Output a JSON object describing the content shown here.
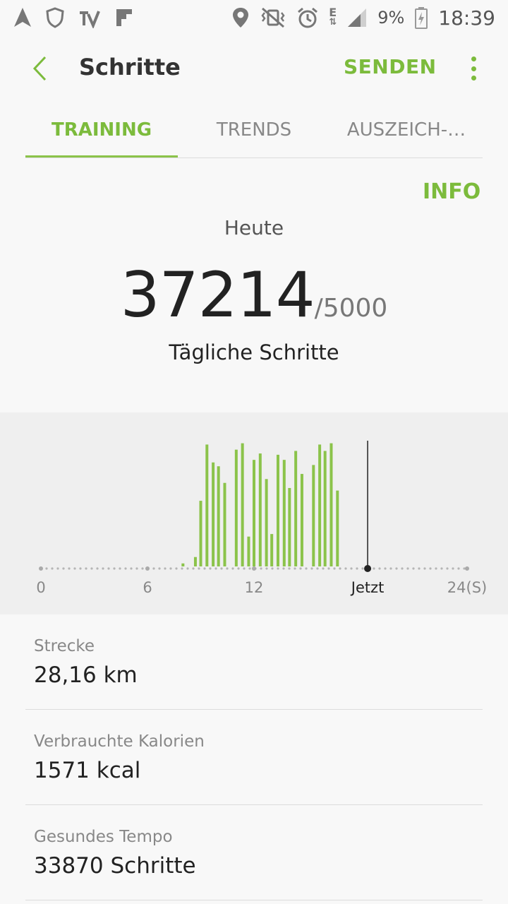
{
  "status_bar": {
    "battery": "9%",
    "time": "18:39",
    "network": "E",
    "icons": [
      "navigation-icon",
      "shield-icon",
      "tv-icon",
      "flipboard-icon",
      "location-icon",
      "vibrate-mute-icon",
      "alarm-icon",
      "network-e-icon",
      "signal-icon",
      "battery-charging-icon"
    ]
  },
  "header": {
    "title": "Schritte",
    "send_label": "SENDEN",
    "accent": "#7cbb3c"
  },
  "tabs": [
    {
      "label": "TRAINING",
      "active": true
    },
    {
      "label": "TRENDS",
      "active": false
    },
    {
      "label": "AUSZEICH-…",
      "active": false
    }
  ],
  "summary": {
    "info_label": "INFO",
    "period": "Heute",
    "steps": "37214",
    "goal": "/5000",
    "label": "Tägliche Schritte"
  },
  "chart_data": {
    "type": "bar",
    "x_ticks": [
      "0",
      "6",
      "12",
      "Jetzt",
      "24(S)"
    ],
    "x_tick_hours": [
      0,
      6,
      12,
      18.4,
      24
    ],
    "now_hour": 18.4,
    "xlim": [
      0,
      24
    ],
    "ylim": [
      0,
      1
    ],
    "bar_color": "#8bc34a",
    "bars": [
      {
        "hour": 8.0,
        "value": 0.04
      },
      {
        "hour": 8.7,
        "value": 0.09
      },
      {
        "hour": 9.0,
        "value": 0.53
      },
      {
        "hour": 9.35,
        "value": 0.97
      },
      {
        "hour": 9.7,
        "value": 0.83
      },
      {
        "hour": 10.0,
        "value": 0.8
      },
      {
        "hour": 10.35,
        "value": 0.67
      },
      {
        "hour": 11.0,
        "value": 0.93
      },
      {
        "hour": 11.35,
        "value": 0.98
      },
      {
        "hour": 11.7,
        "value": 0.25
      },
      {
        "hour": 12.0,
        "value": 0.85
      },
      {
        "hour": 12.35,
        "value": 0.9
      },
      {
        "hour": 12.7,
        "value": 0.7
      },
      {
        "hour": 13.0,
        "value": 0.27
      },
      {
        "hour": 13.35,
        "value": 0.89
      },
      {
        "hour": 13.7,
        "value": 0.85
      },
      {
        "hour": 14.0,
        "value": 0.63
      },
      {
        "hour": 14.35,
        "value": 0.92
      },
      {
        "hour": 14.7,
        "value": 0.74
      },
      {
        "hour": 15.35,
        "value": 0.81
      },
      {
        "hour": 15.7,
        "value": 0.97
      },
      {
        "hour": 16.0,
        "value": 0.92
      },
      {
        "hour": 16.35,
        "value": 0.98
      },
      {
        "hour": 16.7,
        "value": 0.61
      }
    ]
  },
  "stats": [
    {
      "label": "Strecke",
      "value": "28,16 km"
    },
    {
      "label": "Verbrauchte Kalorien",
      "value": "1571 kcal"
    },
    {
      "label": "Gesundes Tempo",
      "value": "33870 Schritte"
    }
  ]
}
